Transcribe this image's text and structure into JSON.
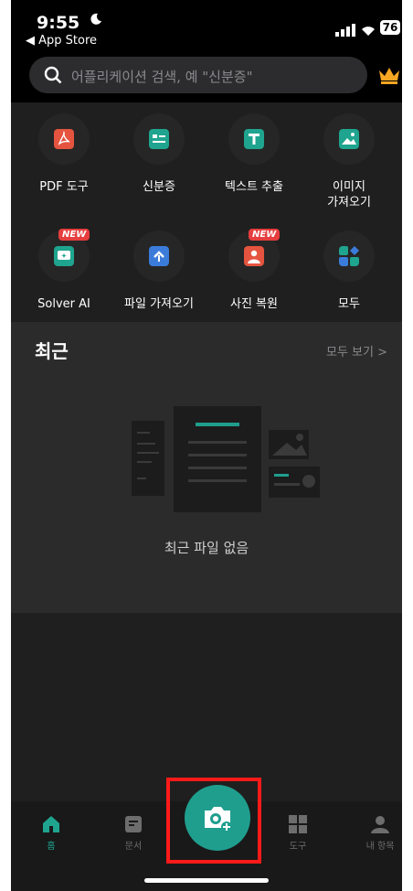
{
  "status": {
    "time": "9:55",
    "back_app": "◀ App Store",
    "battery": "76"
  },
  "search": {
    "placeholder": "어플리케이션 검색, 예 \"신분증\""
  },
  "tools": [
    {
      "label": "PDF 도구",
      "color": "#e5543f",
      "icon": "pdf-icon"
    },
    {
      "label": "신분증",
      "color": "#1fa48f",
      "icon": "id-card-icon"
    },
    {
      "label": "텍스트 추출",
      "color": "#1fa48f",
      "icon": "text-extract-icon"
    },
    {
      "label": "이미지\n가져오기",
      "color": "#1fa48f",
      "icon": "image-import-icon"
    },
    {
      "label": "Solver AI",
      "color": "#1fa48f",
      "icon": "solver-ai-icon",
      "badge": "NEW"
    },
    {
      "label": "파일 가져오기",
      "color": "#3b7cdb",
      "icon": "file-import-icon"
    },
    {
      "label": "사진 복원",
      "color": "#e5543f",
      "icon": "photo-restore-icon",
      "badge": "NEW"
    },
    {
      "label": "모두",
      "color": "#1fa48f",
      "icon": "all-tools-icon"
    }
  ],
  "recent": {
    "title": "최근",
    "see_all": "모두 보기 >",
    "empty": "최근 파일 없음"
  },
  "nav": {
    "home": "홈",
    "docs": "문서",
    "tools": "도구",
    "mine": "내 항목"
  },
  "colors": {
    "accent": "#1fa48f",
    "highlight": "#ff1a1a"
  }
}
